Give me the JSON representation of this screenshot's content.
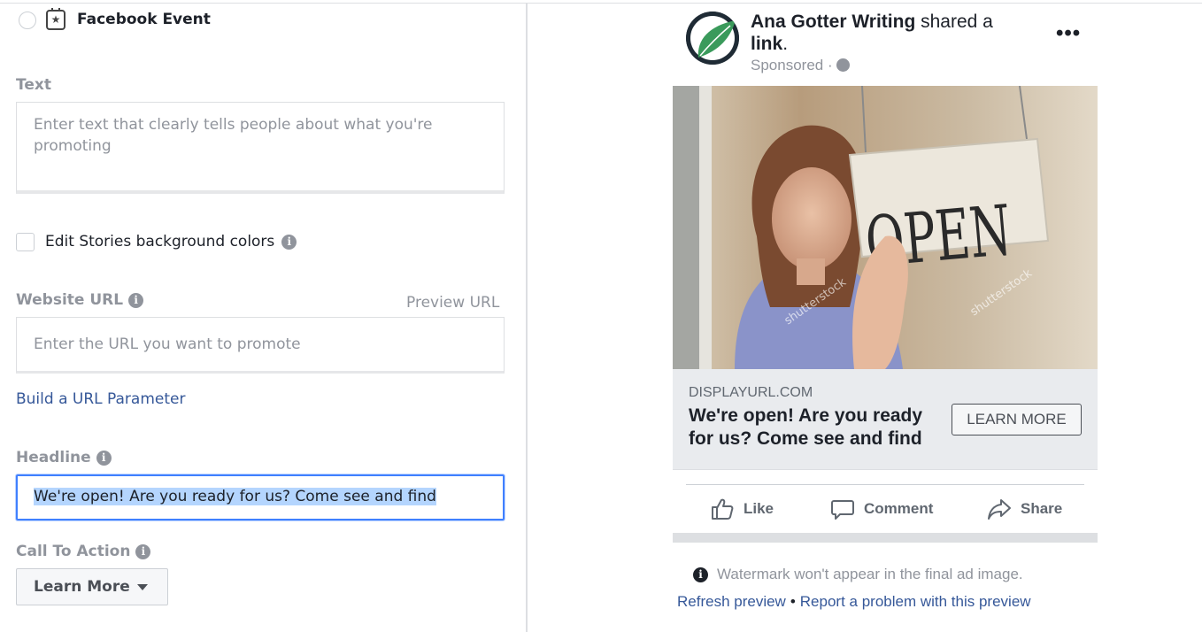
{
  "form": {
    "event_option": {
      "label": "Facebook Event"
    },
    "text": {
      "label": "Text",
      "placeholder": "Enter text that clearly tells people about what you're promoting"
    },
    "stories": {
      "label": "Edit Stories background colors"
    },
    "website_url": {
      "label": "Website URL",
      "preview_link": "Preview URL",
      "placeholder": "Enter the URL you want to promote"
    },
    "build_link": "Build a URL Parameter",
    "headline": {
      "label": "Headline",
      "value": "We're open! Are you ready for us? Come see and find"
    },
    "cta": {
      "label": "Call To Action",
      "value": "Learn More"
    },
    "info_glyph": "i"
  },
  "preview": {
    "page_name": "Ana Gotter Writing",
    "action_text": "shared a",
    "action_object": "link",
    "sponsored": "Sponsored",
    "sponsored_sep": "·",
    "more": "•••",
    "image": {
      "sign_text": "OPEN",
      "watermark": "shutterstock"
    },
    "link": {
      "display_url": "DISPLAYURL.COM",
      "headline": "We're open! Are you ready for us? Come see and find",
      "cta": "LEARN MORE"
    },
    "actions": {
      "like": "Like",
      "comment": "Comment",
      "share": "Share"
    },
    "notice": "Watermark won't appear in the final ad image.",
    "footer": {
      "refresh": "Refresh preview",
      "separator": "•",
      "report": "Report a problem with this preview"
    }
  },
  "colors": {
    "link": "#365899",
    "focus": "#4080ff",
    "label": "#90949c",
    "selection": "#b4d5fe"
  }
}
